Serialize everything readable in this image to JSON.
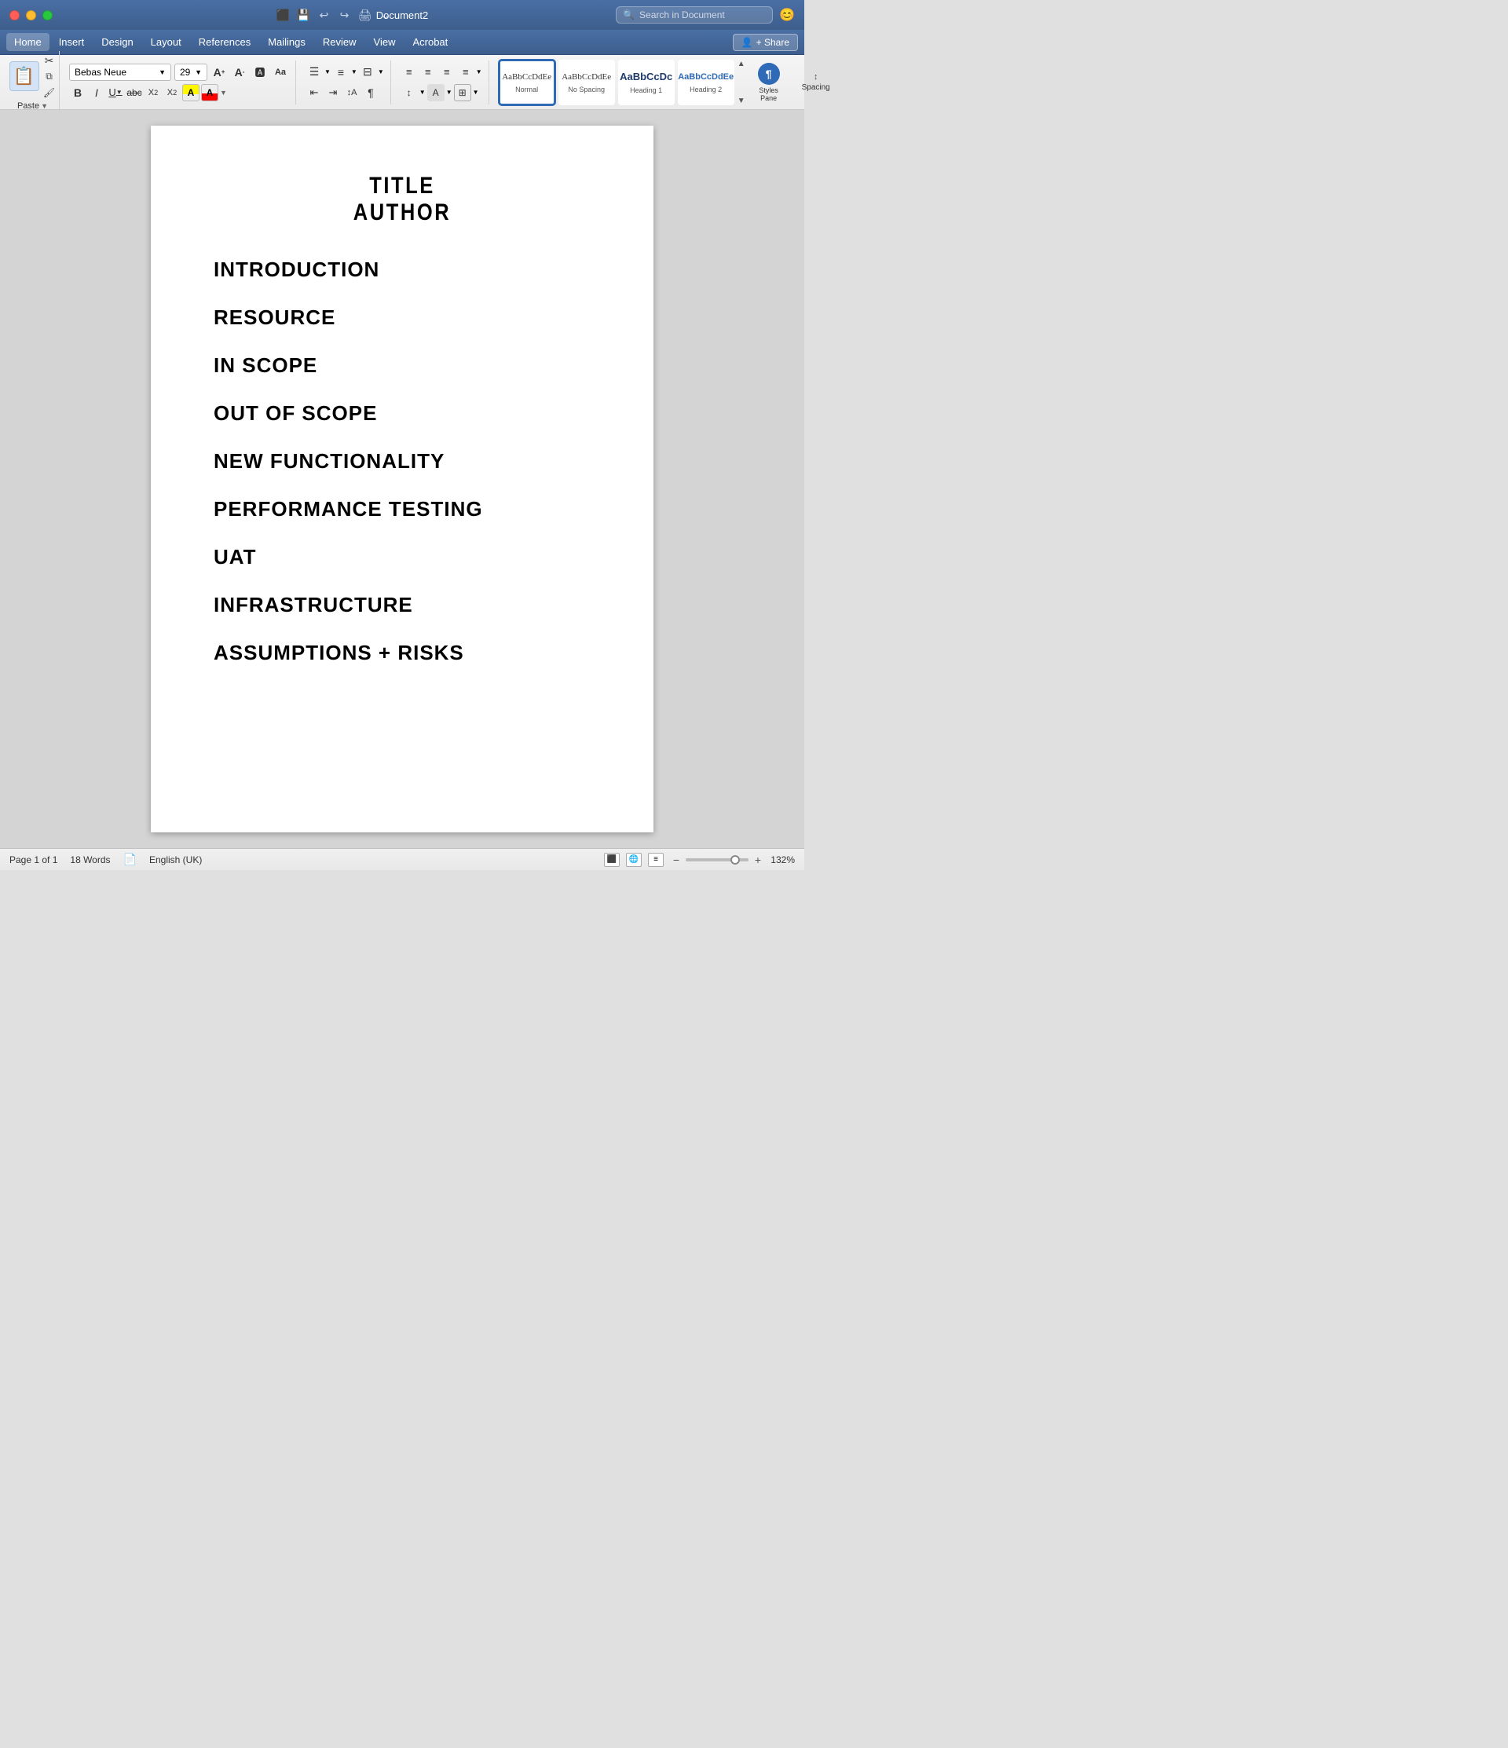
{
  "window": {
    "title": "Document2"
  },
  "titlebar": {
    "traffic_lights": [
      "red",
      "yellow",
      "green"
    ],
    "icons": [
      "sidebar",
      "save",
      "undo",
      "redo",
      "print",
      "more"
    ],
    "search_placeholder": "Search in Document",
    "emoji": "😊"
  },
  "menubar": {
    "items": [
      "Home",
      "Insert",
      "Design",
      "Layout",
      "References",
      "Mailings",
      "Review",
      "View",
      "Acrobat"
    ],
    "active": "Home",
    "share_label": "+ Share"
  },
  "ribbon": {
    "paste_label": "Paste",
    "font": {
      "name": "Bebas Neue",
      "size": "29",
      "bold": "B",
      "italic": "I",
      "underline": "U",
      "strikethrough": "abc",
      "subscript": "A",
      "superscript": "A"
    },
    "styles": [
      {
        "preview": "AaBbCcDdEe",
        "label": "Normal",
        "selected": true
      },
      {
        "preview": "AaBbCcDdEe",
        "label": "No Spacing",
        "selected": false
      },
      {
        "preview": "AaBbCcDc",
        "label": "Heading 1",
        "selected": false
      },
      {
        "preview": "AaBbCcDdEe",
        "label": "Heading 2",
        "selected": false
      }
    ],
    "styles_pane_label": "Styles\nPane",
    "spacing_label": "Spacing"
  },
  "document": {
    "title": "TITLE",
    "author": "AUTHOR",
    "headings": [
      "INTRODUCTION",
      "RESOURCE",
      "IN SCOPE",
      "OUT OF SCOPE",
      "NEW FUNCTIONALITY",
      "PERFORMANCE TESTING",
      "UAT",
      "INFRASTRUCTURE",
      "ASSUMPTIONS + RISKS"
    ]
  },
  "statusbar": {
    "page_info": "Page 1 of 1",
    "word_count": "18 Words",
    "language": "English (UK)",
    "zoom": "132%"
  }
}
